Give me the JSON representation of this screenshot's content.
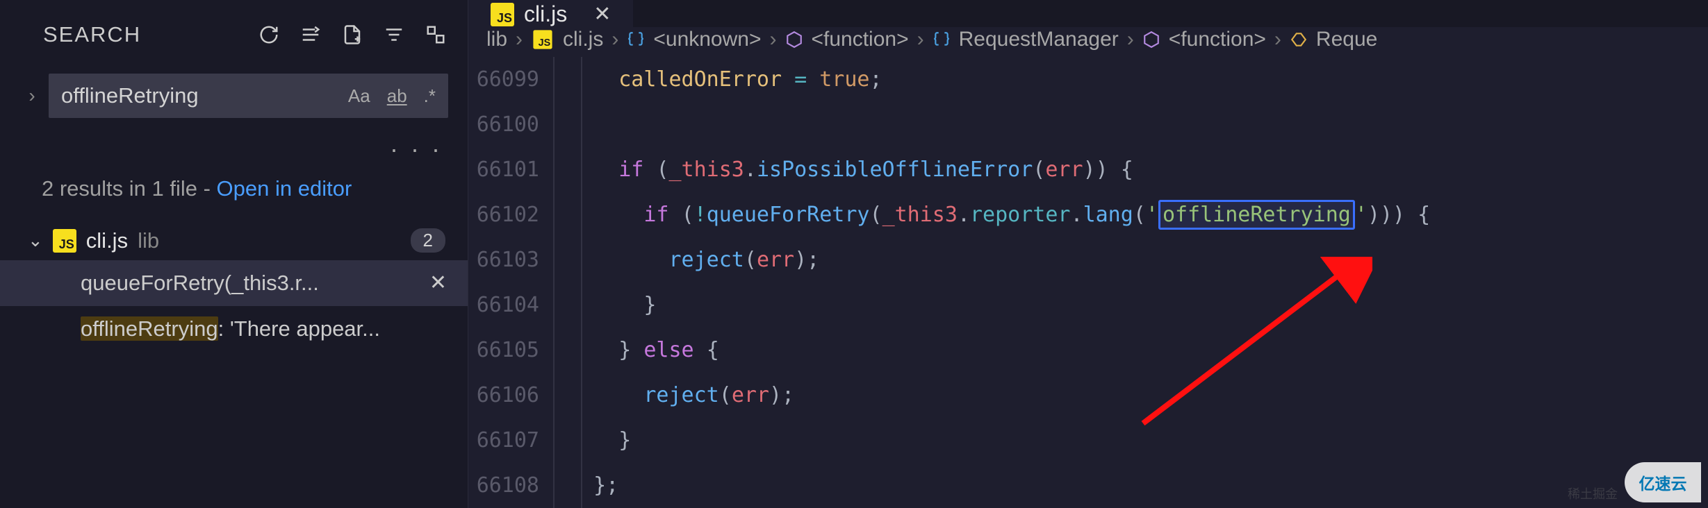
{
  "sidebar": {
    "title": "SEARCH",
    "query": "offlineRetrying",
    "toggle_case": "Aa",
    "toggle_word": "ab",
    "toggle_regex": ".*",
    "ellipsis": "· · ·",
    "summary_prefix": "2 results in 1 file - ",
    "summary_link": "Open in editor",
    "file": {
      "name": "cli.js",
      "path": "lib",
      "count": "2"
    },
    "results": [
      {
        "text": "queueForRetry(_this3.r..."
      },
      {
        "text_prefix": "",
        "hl": "offlineRetrying",
        "text_suffix": ": 'There appear..."
      }
    ]
  },
  "tab": {
    "name": "cli.js"
  },
  "breadcrumb": {
    "parts": [
      "lib",
      "cli.js",
      "<unknown>",
      "<function>",
      "RequestManager",
      "<function>",
      "Reque"
    ]
  },
  "code": {
    "lines": [
      {
        "n": "66099",
        "indent": 2,
        "html": "<span class='tok-var'>calledOnError</span> <span class='tok-op'>=</span> <span class='tok-bool'>true</span><span class='tok-punc'>;</span>"
      },
      {
        "n": "66100",
        "indent": 0,
        "html": ""
      },
      {
        "n": "66101",
        "indent": 2,
        "html": "<span class='tok-kw'>if</span> <span class='tok-punc'>(</span><span class='tok-id'>_this3</span><span class='tok-punc'>.</span><span class='tok-fn'>isPossibleOfflineError</span><span class='tok-punc'>(</span><span class='tok-id'>err</span><span class='tok-punc'>)) {</span>"
      },
      {
        "n": "66102",
        "indent": 3,
        "html": "<span class='tok-kw'>if</span> <span class='tok-punc'>(</span><span class='tok-op'>!</span><span class='tok-fn'>queueForRetry</span><span class='tok-punc'>(</span><span class='tok-id'>_this3</span><span class='tok-punc'>.</span><span class='tok-prop'>reporter</span><span class='tok-punc'>.</span><span class='tok-fn'>lang</span><span class='tok-punc'>(</span><span class='tok-str'>'</span><span class='match-box tok-str' data-name='search-match-highlight' data-interactable='false'>offlineRetrying</span><span class='tok-str'>'</span><span class='tok-punc'>))) {</span>"
      },
      {
        "n": "66103",
        "indent": 4,
        "html": "<span class='tok-fn'>reject</span><span class='tok-punc'>(</span><span class='tok-id'>err</span><span class='tok-punc'>);</span>"
      },
      {
        "n": "66104",
        "indent": 3,
        "html": "<span class='tok-punc'>}</span>"
      },
      {
        "n": "66105",
        "indent": 2,
        "html": "<span class='tok-punc'>}</span> <span class='tok-kw'>else</span> <span class='tok-punc'>{</span>"
      },
      {
        "n": "66106",
        "indent": 3,
        "html": "<span class='tok-fn'>reject</span><span class='tok-punc'>(</span><span class='tok-id'>err</span><span class='tok-punc'>);</span>"
      },
      {
        "n": "66107",
        "indent": 2,
        "html": "<span class='tok-punc'>}</span>"
      },
      {
        "n": "66108",
        "indent": 1,
        "html": "<span class='tok-punc'>};</span>"
      }
    ]
  },
  "watermark": {
    "text": "稀土掘金",
    "badge": "亿速云"
  }
}
